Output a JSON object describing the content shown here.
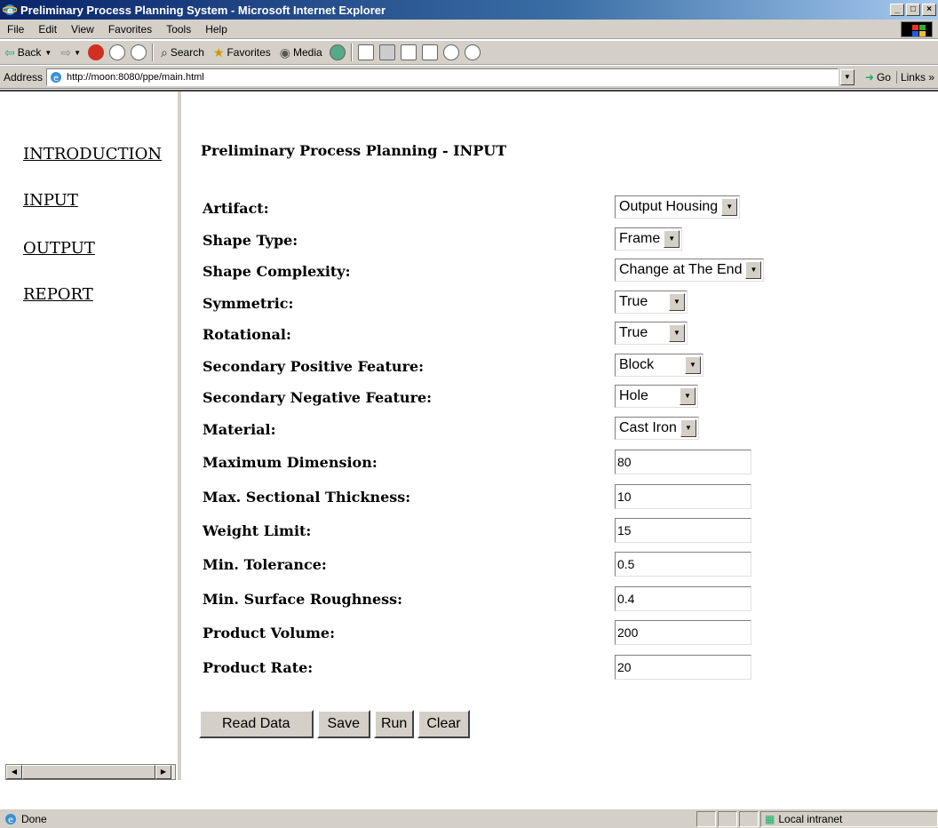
{
  "window": {
    "title": "Preliminary Process Planning System - Microsoft Internet Explorer",
    "min_glyph": "_",
    "max_glyph": "□",
    "close_glyph": "×"
  },
  "menu": [
    {
      "name": "file",
      "label": "File"
    },
    {
      "name": "edit",
      "label": "Edit"
    },
    {
      "name": "view",
      "label": "View"
    },
    {
      "name": "favorites",
      "label": "Favorites"
    },
    {
      "name": "tools",
      "label": "Tools"
    },
    {
      "name": "help",
      "label": "Help"
    }
  ],
  "toolbar": {
    "back": "Back",
    "search": "Search",
    "favorites": "Favorites",
    "media": "Media"
  },
  "address": {
    "label": "Address",
    "url": "http://moon:8080/ppe/main.html",
    "go": "Go",
    "links": "Links »"
  },
  "nav": {
    "introduction": "INTRODUCTION",
    "input": "INPUT",
    "output": "OUTPUT",
    "report": "REPORT"
  },
  "form": {
    "title": "Preliminary Process Planning - INPUT",
    "selects": [
      {
        "label": "Artifact:",
        "value": "Output Housing"
      },
      {
        "label": "Shape Type:",
        "value": "Frame"
      },
      {
        "label": "Shape Complexity:",
        "value": "Change at The End"
      },
      {
        "label": "Symmetric:",
        "value": "True"
      },
      {
        "label": "Rotational:",
        "value": "True"
      },
      {
        "label": "Secondary Positive Feature:",
        "value": "Block"
      },
      {
        "label": "Secondary Negative Feature:",
        "value": "Hole"
      },
      {
        "label": "Material:",
        "value": "Cast Iron"
      }
    ],
    "inputs": [
      {
        "label": "Maximum Dimension:",
        "value": "80"
      },
      {
        "label": "Max. Sectional Thickness:",
        "value": "10"
      },
      {
        "label": "Weight Limit:",
        "value": "15"
      },
      {
        "label": "Min. Tolerance:",
        "value": "0.5"
      },
      {
        "label": "Min. Surface Roughness:",
        "value": "0.4"
      },
      {
        "label": "Product Volume:",
        "value": "200"
      },
      {
        "label": "Product Rate:",
        "value": "20"
      }
    ],
    "buttons": {
      "read": "Read Data",
      "save": "Save",
      "run": "Run",
      "clear": "Clear"
    }
  },
  "status": {
    "text": "Done",
    "zone": "Local intranet"
  }
}
